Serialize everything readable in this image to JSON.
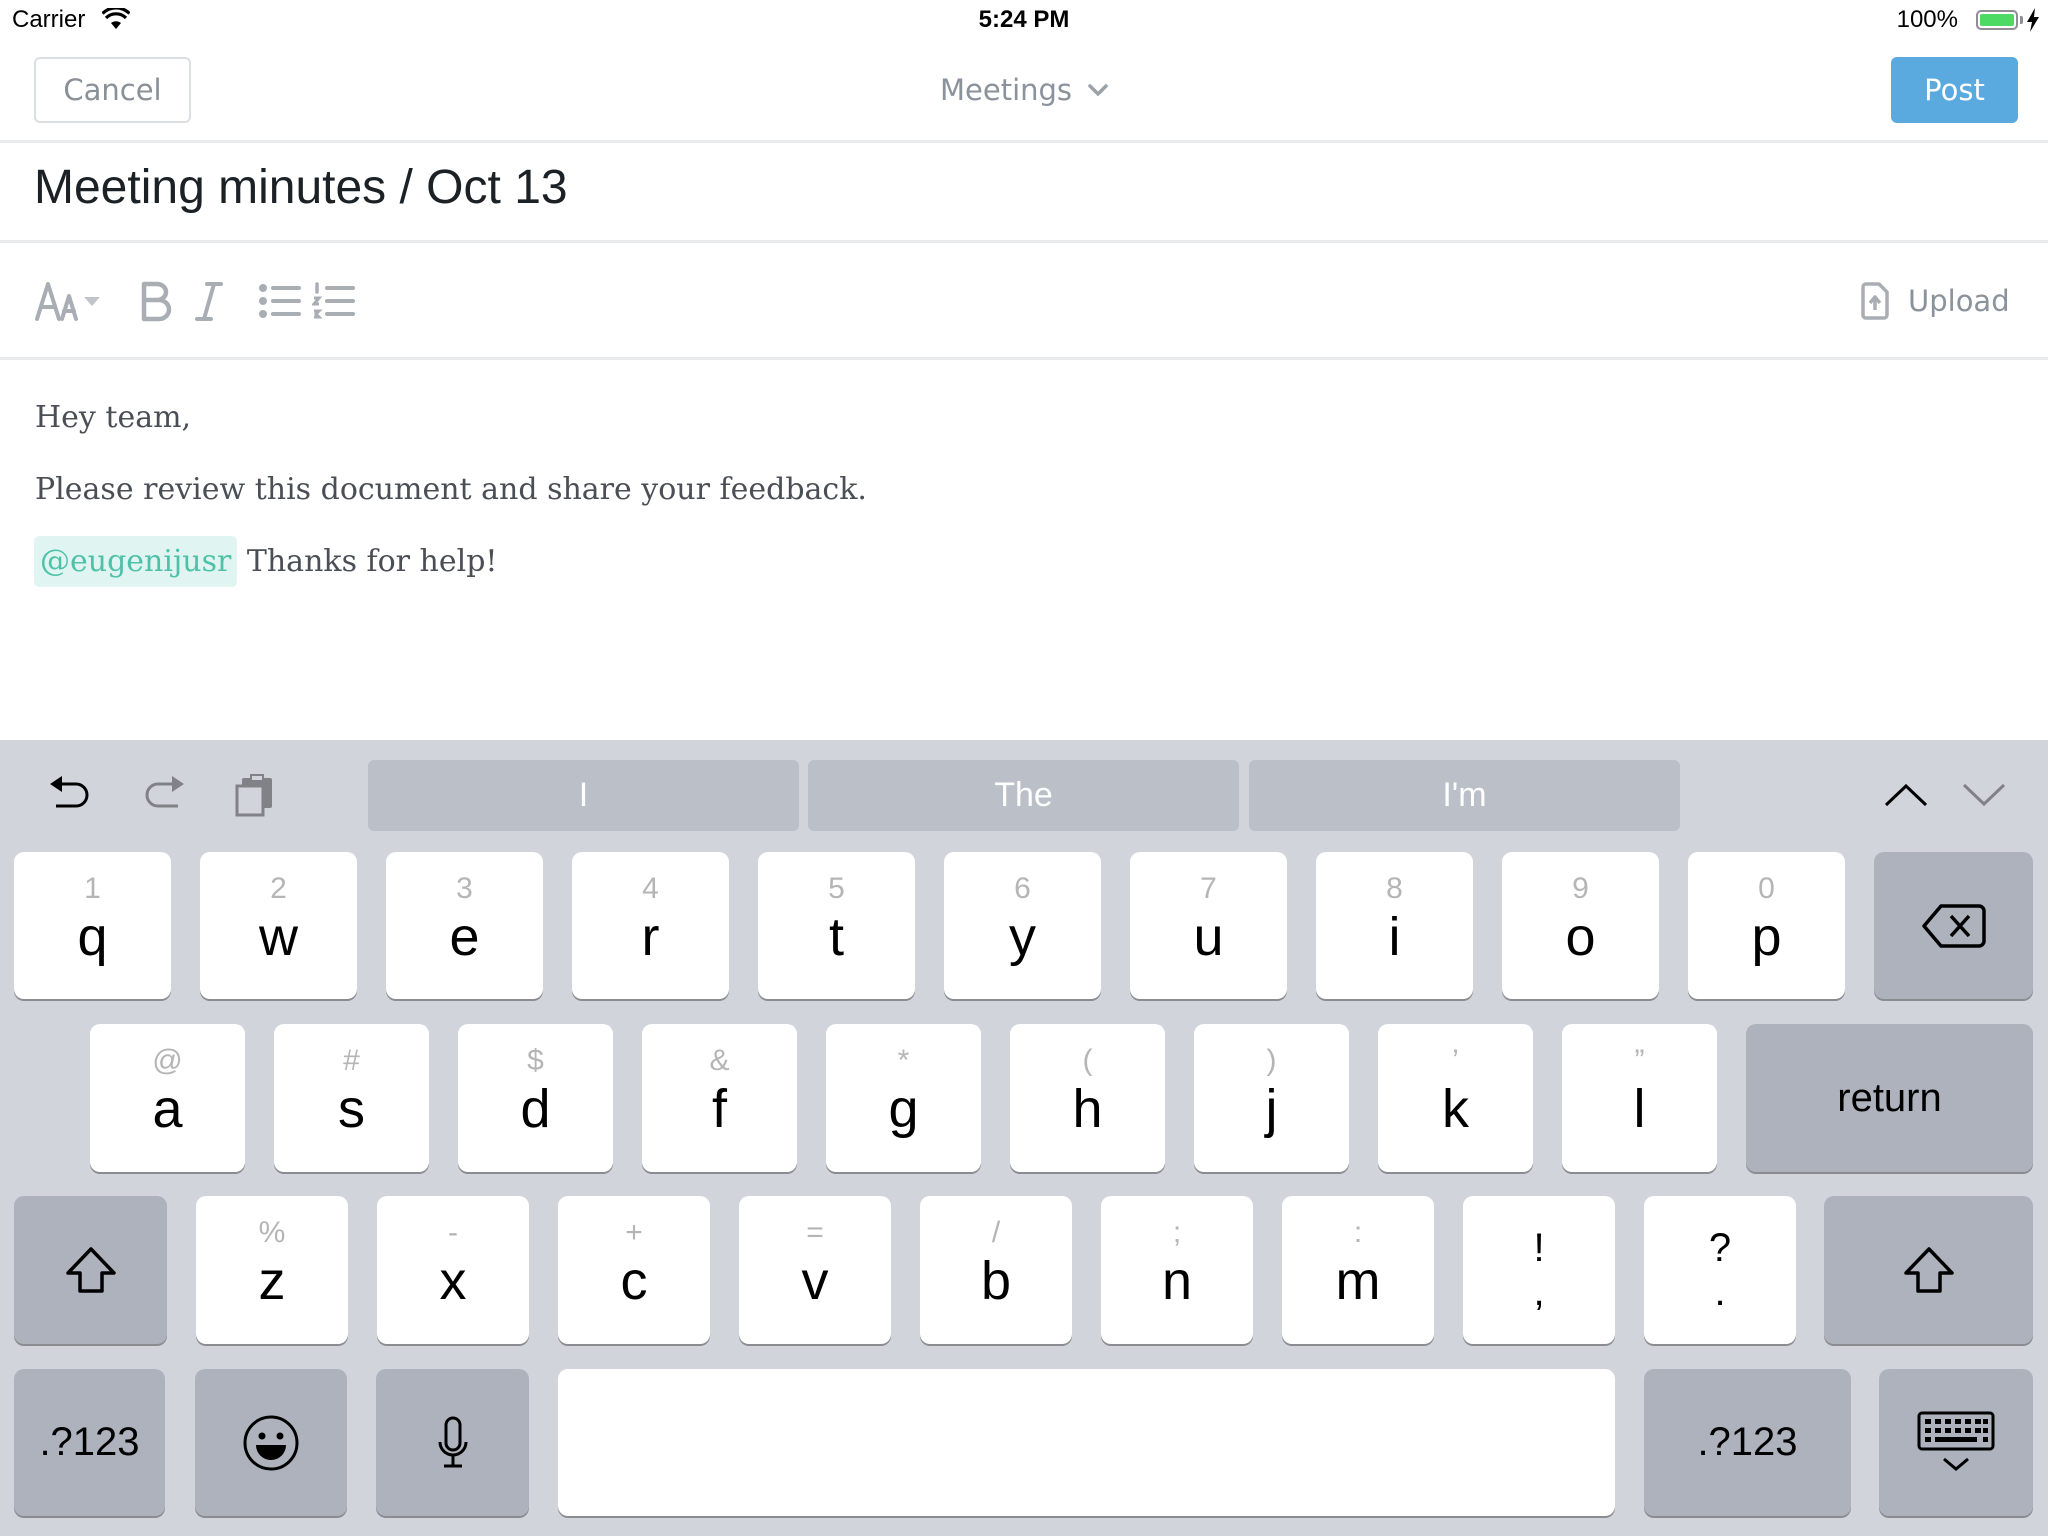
{
  "status_bar": {
    "carrier": "Carrier",
    "time": "5:24 PM",
    "battery_percent": "100%",
    "battery_level": 1.0,
    "charging": true
  },
  "nav": {
    "cancel_label": "Cancel",
    "channel_label": "Meetings",
    "post_label": "Post",
    "post_color": "#5aaadf"
  },
  "title": "Meeting minutes / Oct 13",
  "toolbar": {
    "icons": [
      "text-size-icon",
      "bold-icon",
      "italic-icon",
      "bulleted-list-icon",
      "numbered-list-icon"
    ],
    "upload_label": "Upload"
  },
  "body": {
    "line1": "Hey team,",
    "line2": "Please review this document and share your feedback.",
    "mention": "@eugenijusr",
    "line3_rest": " Thanks for help!",
    "mention_color": "#4fc1a8"
  },
  "keyboard": {
    "suggestions": [
      "I",
      "The",
      "I'm"
    ],
    "row1": [
      {
        "pri": "q",
        "sec": "1"
      },
      {
        "pri": "w",
        "sec": "2"
      },
      {
        "pri": "e",
        "sec": "3"
      },
      {
        "pri": "r",
        "sec": "4"
      },
      {
        "pri": "t",
        "sec": "5"
      },
      {
        "pri": "y",
        "sec": "6"
      },
      {
        "pri": "u",
        "sec": "7"
      },
      {
        "pri": "i",
        "sec": "8"
      },
      {
        "pri": "o",
        "sec": "9"
      },
      {
        "pri": "p",
        "sec": "0"
      }
    ],
    "row2": [
      {
        "pri": "a",
        "sec": "@"
      },
      {
        "pri": "s",
        "sec": "#"
      },
      {
        "pri": "d",
        "sec": "$"
      },
      {
        "pri": "f",
        "sec": "&"
      },
      {
        "pri": "g",
        "sec": "*"
      },
      {
        "pri": "h",
        "sec": "("
      },
      {
        "pri": "j",
        "sec": ")"
      },
      {
        "pri": "k",
        "sec": "’"
      },
      {
        "pri": "l",
        "sec": "”"
      }
    ],
    "row3": [
      {
        "pri": "z",
        "sec": "%"
      },
      {
        "pri": "x",
        "sec": "-"
      },
      {
        "pri": "c",
        "sec": "+"
      },
      {
        "pri": "v",
        "sec": "="
      },
      {
        "pri": "b",
        "sec": "/"
      },
      {
        "pri": "n",
        "sec": ";"
      },
      {
        "pri": "m",
        "sec": ":"
      }
    ],
    "punct": [
      {
        "top": "!",
        "bottom": ","
      },
      {
        "top": "?",
        "bottom": "."
      }
    ],
    "return_label": "return",
    "numbers_label": ".?123",
    "space_label": ""
  }
}
